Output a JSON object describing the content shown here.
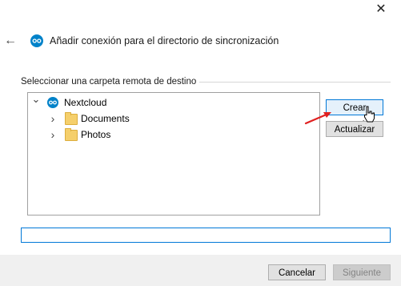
{
  "window": {
    "close_glyph": "✕"
  },
  "header": {
    "back_glyph": "←",
    "logo_icon": "nextcloud-icon",
    "title": "Añadir conexión para el directorio de sincronización"
  },
  "remote_folder": {
    "group_label": "Seleccionar una carpeta remota de destino",
    "tree": {
      "root": {
        "label": "Nextcloud",
        "expanded": true,
        "chevron": "⌄"
      },
      "children": [
        {
          "label": "Documents",
          "chevron": "›"
        },
        {
          "label": "Photos",
          "chevron": "›"
        }
      ]
    },
    "buttons": {
      "create_folder": "Crear carpeta",
      "refresh": "Actualizar"
    },
    "path_value": ""
  },
  "footer": {
    "cancel_label": "Cancelar",
    "next_label": "Siguiente"
  },
  "colors": {
    "accent": "#0078d7",
    "nextcloud_blue": "#0082c9",
    "annotation_arrow": "#e02020"
  }
}
